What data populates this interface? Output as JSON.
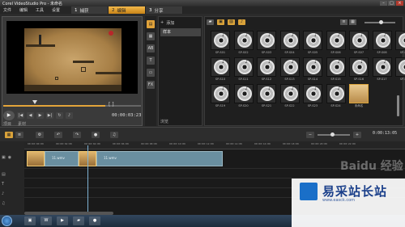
{
  "app": {
    "title": "Corel VideoStudio Pro - 未命名"
  },
  "menu": [
    "文件",
    "编辑",
    "工具",
    "设置"
  ],
  "steps": [
    {
      "num": "1",
      "label": "捕获"
    },
    {
      "num": "2",
      "label": "编辑"
    },
    {
      "num": "3",
      "label": "分享"
    }
  ],
  "preview": {
    "timecode": "00:00:03:23",
    "mode_labels": [
      "项目",
      "素材"
    ]
  },
  "library": {
    "add_label": "添加",
    "folder_name": "样本",
    "browse_label": "浏览",
    "items": [
      "SP-S01",
      "SP-S02",
      "SP-S03",
      "SP-S04",
      "SP-S05",
      "SP-S06",
      "SP-S07",
      "SP-S08",
      "SP-S09",
      "SP-S10",
      "SP-S11",
      "SP-S12",
      "SP-S13",
      "SP-S14",
      "SP-S15",
      "SP-S16",
      "SP-S17",
      "SP-S18",
      "SP-S19",
      "SP-S20",
      "SP-S21",
      "SP-S22",
      "SP-S23",
      "SP-S24",
      "未命名"
    ]
  },
  "timeline": {
    "timecode": "0:00:13:05",
    "ruler": [
      "00:00:00:00",
      "00:00:02:00",
      "00:00:04:00",
      "00:00:06:00",
      "00:00:08:00",
      "00:00:10:00",
      "00:00:12:00",
      "00:00:14:00",
      "00:00:16:00",
      "00:00:18:00",
      "00:00:20:00",
      "00:00:22:00"
    ],
    "clips": [
      {
        "label": "11.wmv"
      },
      {
        "label": "11.wmv"
      }
    ]
  },
  "watermark": {
    "logo_text": "易采站长站",
    "sub": "www.easck.com",
    "bg_text": "Baidu 经验"
  }
}
